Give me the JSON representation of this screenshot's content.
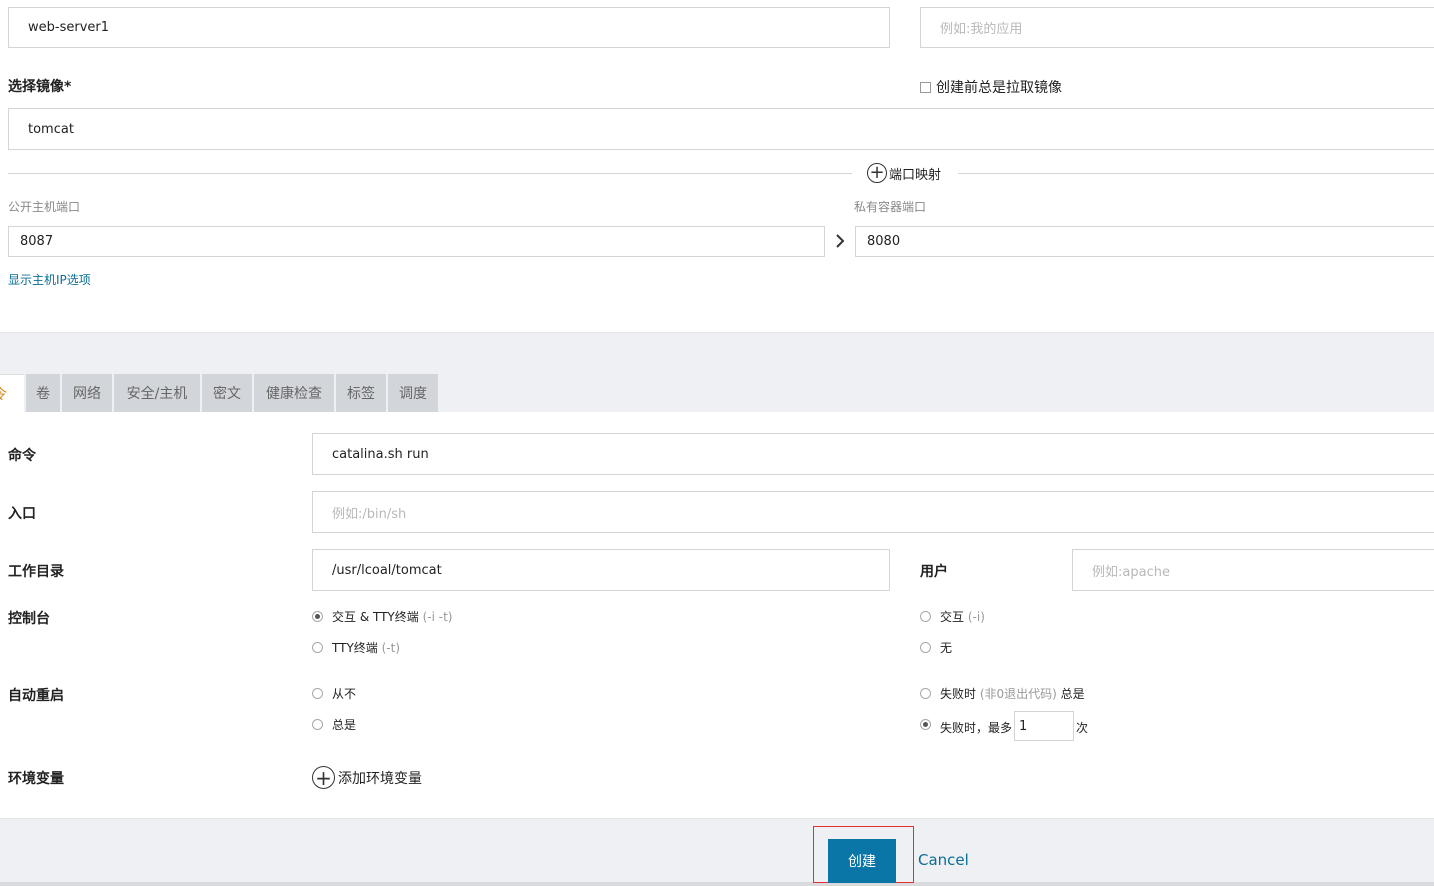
{
  "header": {
    "name_value": "web-server1",
    "description_placeholder": "例如:我的应用"
  },
  "image": {
    "label": "选择镜像*",
    "value": "tomcat",
    "always_pull_label": "创建前总是拉取镜像"
  },
  "ports": {
    "section_title": "端口映射",
    "public_label": "公开主机端口",
    "private_label": "私有容器端口",
    "public_value": "8087",
    "private_value": "8080",
    "show_host_ip_link": "显示主机IP选项"
  },
  "tabs": [
    {
      "label": "令"
    },
    {
      "label": "卷"
    },
    {
      "label": "网络"
    },
    {
      "label": "安全/主机"
    },
    {
      "label": "密文"
    },
    {
      "label": "健康检查"
    },
    {
      "label": "标签"
    },
    {
      "label": "调度"
    }
  ],
  "command": {
    "label": "命令",
    "value": "catalina.sh run"
  },
  "entrypoint": {
    "label": "入口",
    "placeholder": "例如:/bin/sh"
  },
  "workdir": {
    "label": "工作目录",
    "value": "/usr/lcoal/tomcat"
  },
  "user": {
    "label": "用户",
    "placeholder": "例如:apache"
  },
  "console": {
    "label": "控制台",
    "options": [
      {
        "label": "交互 & TTY终端",
        "hint": "(-i -t)",
        "checked": true
      },
      {
        "label": "交互",
        "hint": "(-i)",
        "checked": false
      },
      {
        "label": "TTY终端",
        "hint": "(-t)",
        "checked": false
      },
      {
        "label": "无",
        "hint": "",
        "checked": false
      }
    ]
  },
  "restart": {
    "label": "自动重启",
    "never": "从不",
    "always": "总是",
    "on_failure_prefix": "失败时",
    "on_failure_hint": "(非0退出代码)",
    "on_failure_suffix": "总是",
    "on_failure_max_prefix": "失败时，最多",
    "on_failure_max_value": "1",
    "on_failure_max_suffix": "次",
    "selected": "on_failure_max"
  },
  "env": {
    "label": "环境变量",
    "add_label": "添加环境变量"
  },
  "footer": {
    "create_label": "创建",
    "cancel_label": "Cancel"
  },
  "colors": {
    "primary_button": "#0a76a8",
    "link": "#0b6d94",
    "active_tab_icon": "#d58512",
    "highlight_box": "#e03030",
    "panel_bg": "#eef0f3",
    "tab_bg": "#d2d6da"
  }
}
